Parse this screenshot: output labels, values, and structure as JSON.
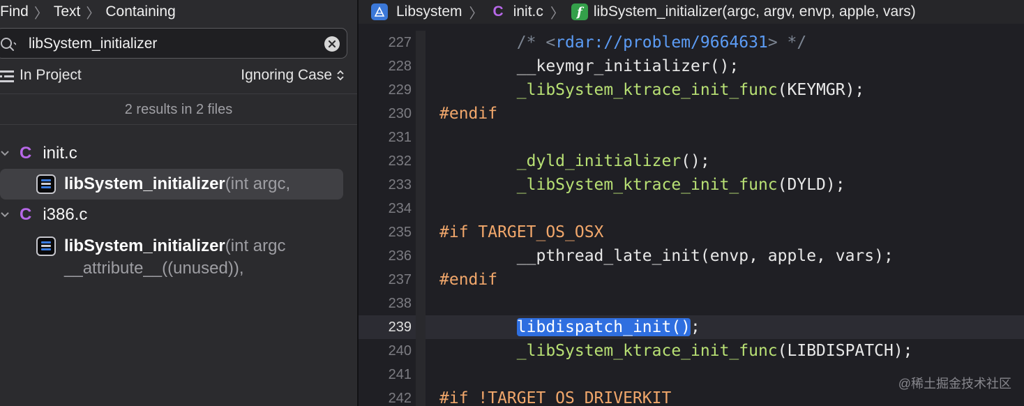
{
  "navigator": {
    "breadcrumb": [
      "Find",
      "Text",
      "Containing"
    ],
    "search": {
      "value": "libSystem_initializer"
    },
    "scope": "In Project",
    "case_mode": "Ignoring Case",
    "summary": "2 results in 2 files",
    "results": [
      {
        "file": "init.c",
        "file_icon": "c-file-icon",
        "match_bold": "libSystem_initializer",
        "match_rest": "(int argc,",
        "match_rest2": ""
      },
      {
        "file": "i386.c",
        "file_icon": "c-file-icon",
        "match_bold": "libSystem_initializer",
        "match_rest": "(int argc",
        "match_rest2": "__attribute__((unused)),"
      }
    ]
  },
  "editor": {
    "jump_bar": {
      "project": "Libsystem",
      "file": "init.c",
      "symbol": "libSystem_initializer(argc, argv, envp, apple, vars)"
    },
    "current_line": "239",
    "lines": [
      {
        "no": "227",
        "text": "        /* <rdar://problem/9664631> */"
      },
      {
        "no": "228",
        "text": "        __keymgr_initializer();"
      },
      {
        "no": "229",
        "text": "        _libSystem_ktrace_init_func(KEYMGR);"
      },
      {
        "no": "230",
        "text": "#endif"
      },
      {
        "no": "231",
        "text": ""
      },
      {
        "no": "232",
        "text": "        _dyld_initializer();"
      },
      {
        "no": "233",
        "text": "        _libSystem_ktrace_init_func(DYLD);"
      },
      {
        "no": "234",
        "text": ""
      },
      {
        "no": "235",
        "text": "#if TARGET_OS_OSX"
      },
      {
        "no": "236",
        "text": "        __pthread_late_init(envp, apple, vars);"
      },
      {
        "no": "237",
        "text": "#endif"
      },
      {
        "no": "238",
        "text": ""
      },
      {
        "no": "239",
        "text": "        libdispatch_init();"
      },
      {
        "no": "240",
        "text": "        _libSystem_ktrace_init_func(LIBDISPATCH);"
      },
      {
        "no": "241",
        "text": ""
      },
      {
        "no": "242",
        "text": "#if !TARGET_OS_DRIVERKIT"
      }
    ]
  },
  "watermark": "@稀土掘金技术社区",
  "colors": {
    "accent": "#2f6fe0",
    "c_file": "#b768e8",
    "preprocessor": "#f1a76b",
    "function": "#b8e074",
    "comment": "#7c8592",
    "url": "#5c9cf5"
  }
}
